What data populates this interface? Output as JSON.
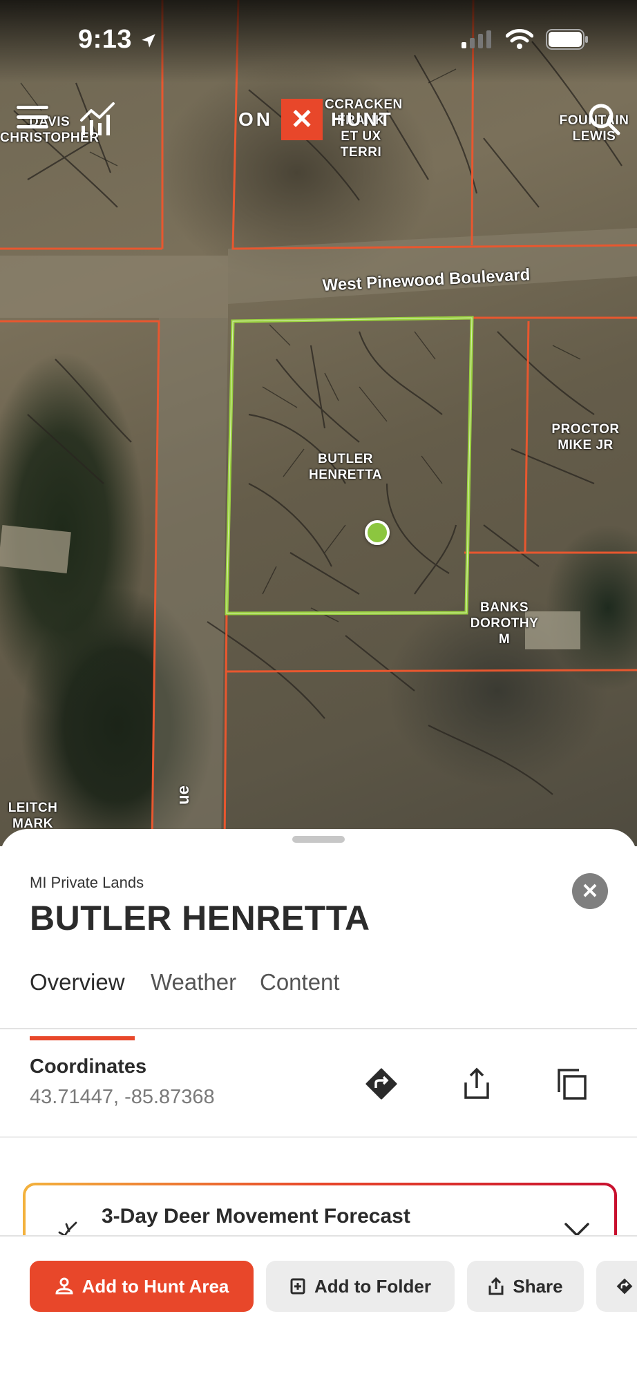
{
  "status_bar": {
    "time": "9:13"
  },
  "header": {
    "logo_on": "ON",
    "logo_x": "✕",
    "logo_hunt": "HUNT",
    "menu_icon": "menu-icon",
    "chart_icon": "chart-icon",
    "search_icon": "search-icon"
  },
  "map": {
    "road_label": "West Pinewood Boulevard",
    "road_label_vertical": "ue",
    "parcel_labels": {
      "davis": "DAVIS\nCHRISTOPHER",
      "mccracken": "CCRACKEN\nFRANK\nET UX\nTERRI",
      "fountain": "FOUNTAIN\nLEWIS",
      "butler": "BUTLER\nHENRETTA",
      "proctor": "PROCTOR\nMIKE JR",
      "banks": "BANKS\nDOROTHY\nM",
      "leitch": "LEITCH\nMARK"
    },
    "colors": {
      "parcel_border": "#e8572f",
      "selected_parcel": "#9ad13f"
    }
  },
  "sheet": {
    "subtitle": "MI Private Lands",
    "title": "BUTLER HENRETTA",
    "close_icon": "✕",
    "tabs": [
      {
        "label": "Overview",
        "active": true
      },
      {
        "label": "Weather",
        "active": false
      },
      {
        "label": "Content",
        "active": false
      }
    ],
    "coordinates": {
      "label": "Coordinates",
      "value": "43.71447, -85.87368",
      "actions": [
        "directions-icon",
        "share-icon",
        "copy-icon"
      ]
    },
    "forecast": {
      "title": "3-Day Deer Movement Forecast",
      "icon": "deer-antler-icon",
      "chevron": "chevron-down-icon"
    }
  },
  "actions": {
    "add_to_hunt_area": "Add to Hunt Area",
    "add_to_folder": "Add to Folder",
    "share": "Share"
  },
  "colors": {
    "accent": "#e8472a",
    "secondary_bg": "#ececec",
    "text": "#2b2b2b"
  }
}
